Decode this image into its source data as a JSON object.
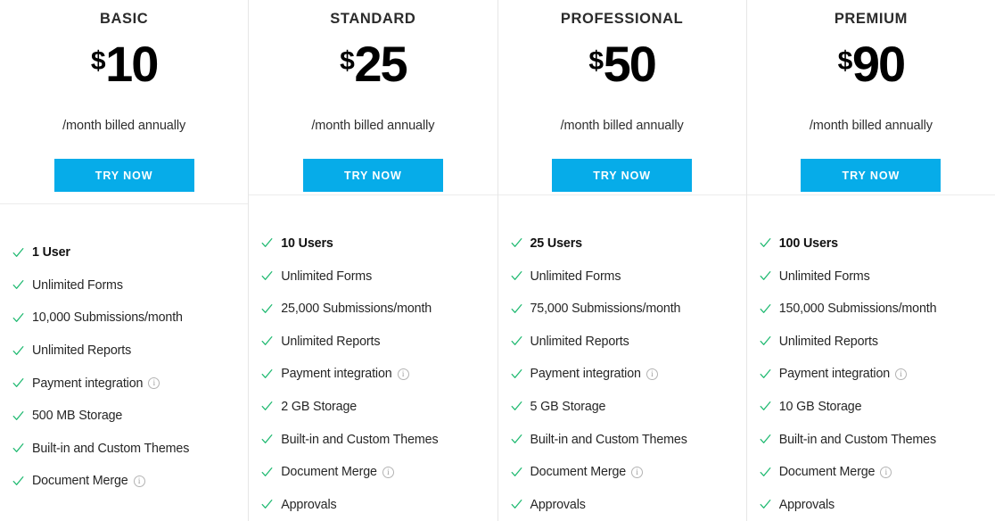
{
  "accent_color": "#06ace9",
  "check_color": "#21ba72",
  "divider_color": "#e6e6e6",
  "icons": {
    "check": "check-icon",
    "info": "info-icon"
  },
  "common": {
    "period_label": "/month billed annually",
    "cta_label": "TRY NOW",
    "currency_symbol": "$"
  },
  "plans": [
    {
      "name": "BASIC",
      "currency": "$",
      "price": "10",
      "period": "/month billed annually",
      "cta": "TRY NOW",
      "features": [
        {
          "label": "1 User",
          "highlight": true,
          "info": false
        },
        {
          "label": "Unlimited Forms",
          "highlight": false,
          "info": false
        },
        {
          "label": "10,000 Submissions/month",
          "highlight": false,
          "info": false
        },
        {
          "label": "Unlimited Reports",
          "highlight": false,
          "info": false
        },
        {
          "label": "Payment integration",
          "highlight": false,
          "info": true
        },
        {
          "label": "500 MB Storage",
          "highlight": false,
          "info": false
        },
        {
          "label": "Built-in and Custom Themes",
          "highlight": false,
          "info": false
        },
        {
          "label": "Document Merge",
          "highlight": false,
          "info": true
        }
      ]
    },
    {
      "name": "STANDARD",
      "currency": "$",
      "price": "25",
      "period": "/month billed annually",
      "cta": "TRY NOW",
      "features": [
        {
          "label": "10 Users",
          "highlight": true,
          "info": false
        },
        {
          "label": "Unlimited Forms",
          "highlight": false,
          "info": false
        },
        {
          "label": "25,000 Submissions/month",
          "highlight": false,
          "info": false
        },
        {
          "label": "Unlimited Reports",
          "highlight": false,
          "info": false
        },
        {
          "label": "Payment integration",
          "highlight": false,
          "info": true
        },
        {
          "label": "2 GB Storage",
          "highlight": false,
          "info": false
        },
        {
          "label": "Built-in and Custom Themes",
          "highlight": false,
          "info": false
        },
        {
          "label": "Document Merge",
          "highlight": false,
          "info": true
        },
        {
          "label": "Approvals",
          "highlight": false,
          "info": false
        }
      ]
    },
    {
      "name": "PROFESSIONAL",
      "currency": "$",
      "price": "50",
      "period": "/month billed annually",
      "cta": "TRY NOW",
      "features": [
        {
          "label": "25 Users",
          "highlight": true,
          "info": false
        },
        {
          "label": "Unlimited Forms",
          "highlight": false,
          "info": false
        },
        {
          "label": "75,000 Submissions/month",
          "highlight": false,
          "info": false
        },
        {
          "label": "Unlimited Reports",
          "highlight": false,
          "info": false
        },
        {
          "label": "Payment integration",
          "highlight": false,
          "info": true
        },
        {
          "label": "5 GB Storage",
          "highlight": false,
          "info": false
        },
        {
          "label": "Built-in and Custom Themes",
          "highlight": false,
          "info": false
        },
        {
          "label": "Document Merge",
          "highlight": false,
          "info": true
        },
        {
          "label": "Approvals",
          "highlight": false,
          "info": false
        }
      ]
    },
    {
      "name": "PREMIUM",
      "currency": "$",
      "price": "90",
      "period": "/month billed annually",
      "cta": "TRY NOW",
      "features": [
        {
          "label": "100 Users",
          "highlight": true,
          "info": false
        },
        {
          "label": "Unlimited Forms",
          "highlight": false,
          "info": false
        },
        {
          "label": "150,000 Submissions/month",
          "highlight": false,
          "info": false
        },
        {
          "label": "Unlimited Reports",
          "highlight": false,
          "info": false
        },
        {
          "label": "Payment integration",
          "highlight": false,
          "info": true
        },
        {
          "label": "10 GB Storage",
          "highlight": false,
          "info": false
        },
        {
          "label": "Built-in and Custom Themes",
          "highlight": false,
          "info": false
        },
        {
          "label": "Document Merge",
          "highlight": false,
          "info": true
        },
        {
          "label": "Approvals",
          "highlight": false,
          "info": false
        }
      ]
    }
  ]
}
